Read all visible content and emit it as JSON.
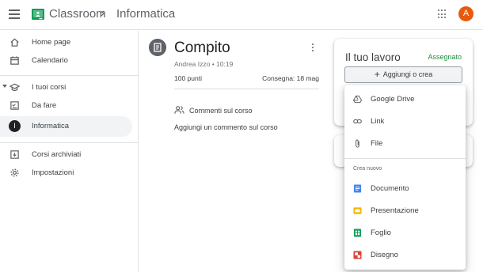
{
  "header": {
    "app_title": "Classroom",
    "separator": "›",
    "class_title": "Informatica",
    "avatar_letter": "A",
    "avatar_color": "#e8590c"
  },
  "sidebar": {
    "items": [
      {
        "label": "Home page",
        "icon": "home-icon"
      },
      {
        "label": "Calendario",
        "icon": "calendar-icon"
      },
      {
        "label": "I tuoi corsi",
        "icon": "school-icon"
      },
      {
        "label": "Da fare",
        "icon": "todo-icon"
      },
      {
        "label": "Informatica",
        "icon": "class-avatar",
        "initial": "I",
        "active": true
      },
      {
        "label": "Corsi archiviati",
        "icon": "archive-icon"
      },
      {
        "label": "Impostazioni",
        "icon": "gear-icon"
      }
    ]
  },
  "assignment": {
    "title": "Compito",
    "meta": "Andrea Izzo • 10:19",
    "points": "100 punti",
    "due": "Consegna: 18 mag",
    "comments_title": "Commenti sul corso",
    "add_comment": "Aggiungi un commento sul corso"
  },
  "work": {
    "title": "Il tuo lavoro",
    "status": "Assegnato",
    "status_color": "#1e8e3e",
    "add_button": "Aggiungi o crea"
  },
  "menu": {
    "attach_items": [
      {
        "label": "Google Drive",
        "icon": "drive-icon"
      },
      {
        "label": "Link",
        "icon": "link-icon"
      },
      {
        "label": "File",
        "icon": "paperclip-icon"
      }
    ],
    "section_label": "Crea nuovo",
    "create_items": [
      {
        "label": "Documento",
        "icon": "docs-icon",
        "color": "#4285f4"
      },
      {
        "label": "Presentazione",
        "icon": "slides-icon",
        "color": "#f4b400"
      },
      {
        "label": "Foglio",
        "icon": "sheets-icon",
        "color": "#0f9d58"
      },
      {
        "label": "Disegno",
        "icon": "drawings-icon",
        "color": "#db4437"
      }
    ]
  }
}
